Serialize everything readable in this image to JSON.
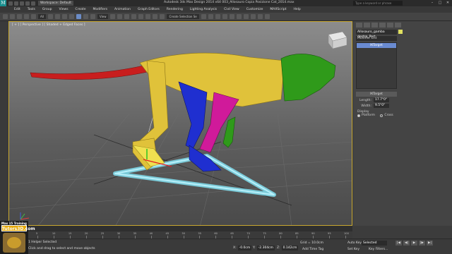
{
  "titlebar": {
    "workspace": "Workspace: Default",
    "title": "Autodesk 3ds Max Design 2014 x64    003_Allosauro Copia Posizione Cat_2014.max",
    "search_placeholder": "Type a keyword or phrase"
  },
  "menu": [
    "Edit",
    "Tools",
    "Group",
    "Views",
    "Create",
    "Modifiers",
    "Animation",
    "Graph Editors",
    "Rendering",
    "Lighting Analysis",
    "Civil View",
    "Customize",
    "MAXScript",
    "Help"
  ],
  "toolbar": {
    "filter_value": "All",
    "ref_coord": "View",
    "named_sel": "Create Selection Se"
  },
  "viewport": {
    "label": "[ + ] [ Perspective ] [ Shaded + Edged Faces ]"
  },
  "command_panel": {
    "object_name": "Allosauro_gamba destra_Port",
    "modifier_list": "Modifier List",
    "stack_item": "IKTarget",
    "rollout_title": "IKTarget",
    "length_label": "Length:",
    "length_value": "17.7\"0\"",
    "width_label": "Width:",
    "width_value": "9.5\"0\"",
    "display_label": "Display",
    "opt_platform": "Platform",
    "opt_cross": "Cross"
  },
  "timeline": {
    "frame": "0 / 100",
    "ticks": [
      "0",
      "5",
      "10",
      "15",
      "20",
      "25",
      "30",
      "35",
      "40",
      "45",
      "50",
      "55",
      "60",
      "65",
      "70",
      "75",
      "80",
      "85",
      "90",
      "95",
      "100"
    ]
  },
  "status": {
    "line1": "1 Helper Selected",
    "line2": "Click and drag to select and move objects",
    "x_label": "X:",
    "x_value": "-0.0cm",
    "y_label": "Y:",
    "y_value": "-2.304cm",
    "z_label": "Z:",
    "z_value": "0.142cm",
    "grid": "Grid = 10.0cm",
    "add_time_tag": "Add Time Tag",
    "auto_key": "Auto Key",
    "set_key": "Set Key",
    "selected": "Selected",
    "key_filters": "Key Filters..."
  },
  "logo": {
    "top_text": "Max 15 Training",
    "brand": "Tutors3D.com"
  },
  "colors": {
    "tail": "#c81e1e",
    "body": "#e0c23a",
    "head": "#2f9a1a",
    "leg_blue": "#1f2fd0",
    "leg_magenta": "#d01a9a",
    "path_cyan": "#7fd8e8"
  }
}
